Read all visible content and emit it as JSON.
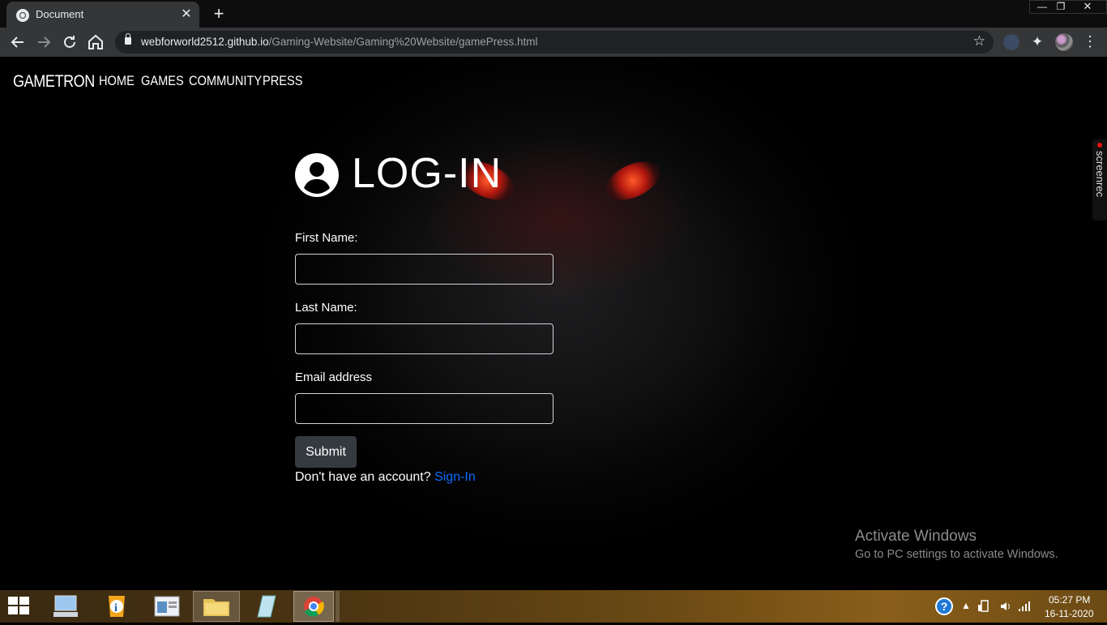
{
  "browser": {
    "tab_title": "Document",
    "tab_close": "✕",
    "new_tab": "+",
    "url_host": "webforworld2512.github.io",
    "url_path": "/Gaming-Website/Gaming%20Website/gamePress.html",
    "window_controls": {
      "minimize": "—",
      "maximize": "❐",
      "close": "✕"
    }
  },
  "site": {
    "brand": "GAMETRON",
    "nav": [
      "HOME",
      "GAMES",
      "COMMUNITY",
      "PRESS"
    ]
  },
  "login": {
    "title": "LOG-IN",
    "first_name_label": "First Name:",
    "last_name_label": "Last Name:",
    "email_label": "Email address",
    "submit_label": "Submit",
    "account_prompt": "Don't have an account?",
    "signin_link": "Sign-In"
  },
  "overlay": {
    "screenrec": "screenrec",
    "activate_title": "Activate Windows",
    "activate_subtitle": "Go to PC settings to activate Windows."
  },
  "taskbar": {
    "time": "05:27 PM",
    "date": "16-11-2020",
    "help": "?"
  },
  "colors": {
    "link": "#0d6efd",
    "button": "#343a40",
    "chrome_toolbar": "#353638",
    "eye_glow": "#ff5a2a"
  }
}
